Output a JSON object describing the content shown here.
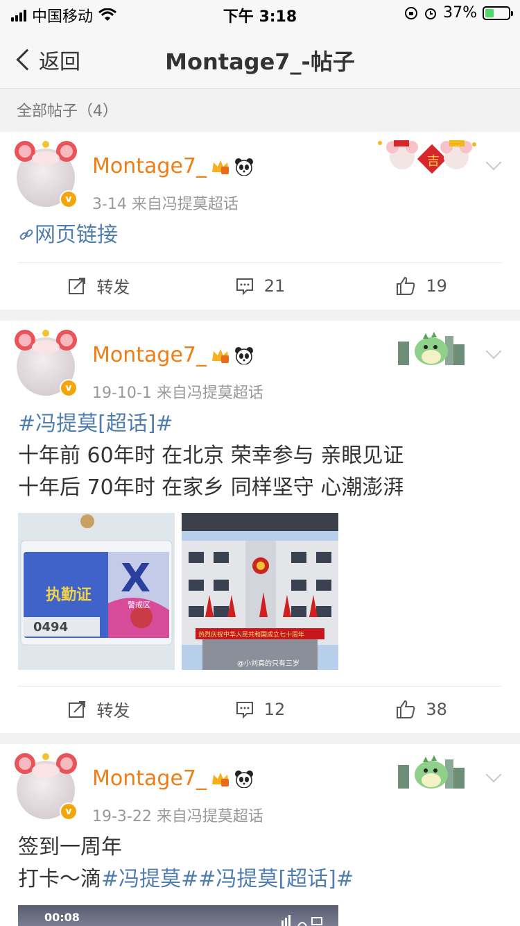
{
  "status": {
    "carrier": "中国移动",
    "time": "下午 3:18",
    "battery": "37%"
  },
  "nav": {
    "back_label": "返回",
    "title": "Montage7_-帖子"
  },
  "section_label": "全部帖子（4）",
  "posts": [
    {
      "username": "Montage7_",
      "meta": "3-14  来自冯提莫超话",
      "link_text": "网页链接",
      "repost_label": "转发",
      "comments": "21",
      "likes": "19"
    },
    {
      "username": "Montage7_",
      "meta": "19-10-1  来自冯提莫超话",
      "topic": "#冯提莫[超话]#",
      "line1": "十年前 60年时 在北京 荣幸参与 亲眼见证",
      "line2": "十年后 70年时 在家乡 同样坚守 心潮澎湃",
      "img1": {
        "number": "0494",
        "zone": "警戒区",
        "title": "执勤证",
        "letter": "X"
      },
      "img2": {
        "banner": "热烈庆祝中华人民共和国成立七十周年",
        "watermark": "@小刘真的只有三岁"
      },
      "repost_label": "转发",
      "comments": "12",
      "likes": "38"
    },
    {
      "username": "Montage7_",
      "meta": "19-3-22  来自冯提莫超话",
      "line1": "签到一周年",
      "line2_prefix": "打卡～滴",
      "line2_topics": "#冯提莫##冯提莫[超话]#",
      "video_time": "00:08"
    }
  ]
}
